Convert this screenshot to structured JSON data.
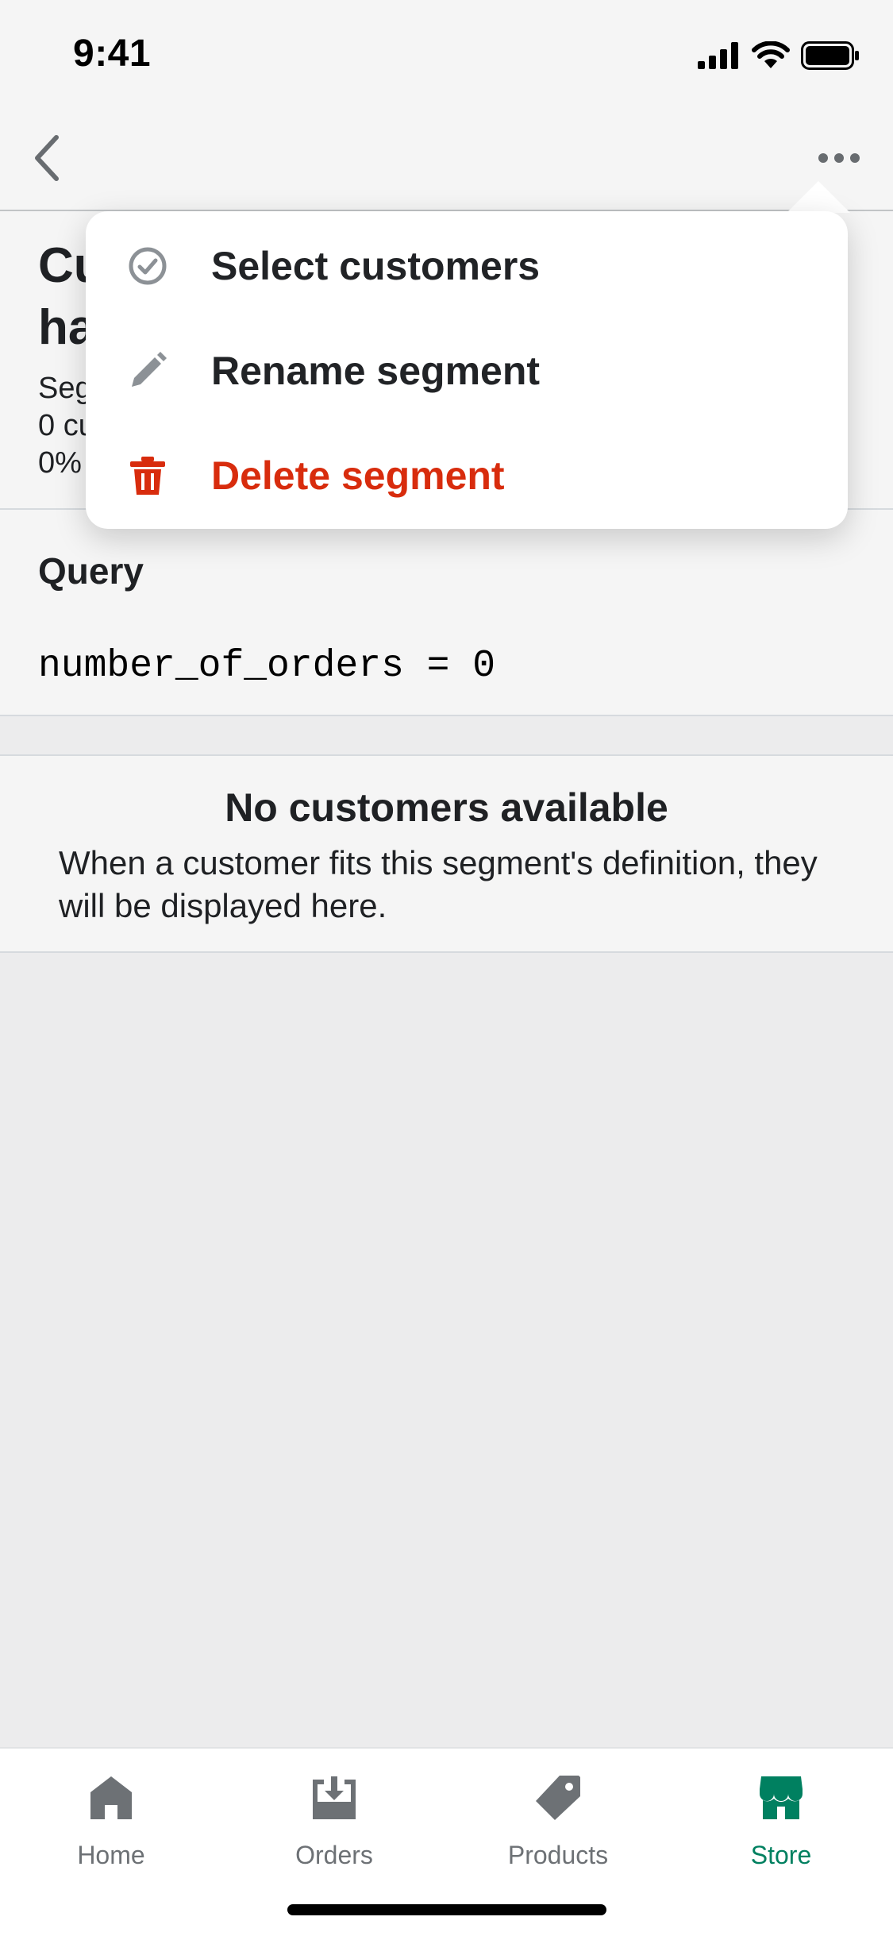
{
  "status_bar": {
    "time": "9:41"
  },
  "nav": {
    "back_icon": "chevron-left-icon",
    "more_icon": "more-horizontal-icon"
  },
  "segment": {
    "title_fragments": [
      "Cu",
      "ha"
    ],
    "meta_fragments": [
      "Seg",
      "0 cu",
      "0%"
    ]
  },
  "query": {
    "label": "Query",
    "code": "number_of_orders = 0"
  },
  "empty_state": {
    "title": "No customers available",
    "description": "When a customer fits this segment's definition, they will be displayed here."
  },
  "menu": {
    "items": [
      {
        "label": "Select customers",
        "icon": "check-circle-icon"
      },
      {
        "label": "Rename segment",
        "icon": "pencil-icon"
      },
      {
        "label": "Delete segment",
        "icon": "trash-icon",
        "color": "#d82c0d"
      }
    ]
  },
  "tab_bar": {
    "tabs": [
      {
        "label": "Home",
        "icon": "home-icon"
      },
      {
        "label": "Orders",
        "icon": "orders-icon"
      },
      {
        "label": "Products",
        "icon": "tag-icon"
      },
      {
        "label": "Store",
        "icon": "store-icon",
        "active": true
      }
    ],
    "active_color": "#008060",
    "inactive_color": "#6d7175"
  }
}
